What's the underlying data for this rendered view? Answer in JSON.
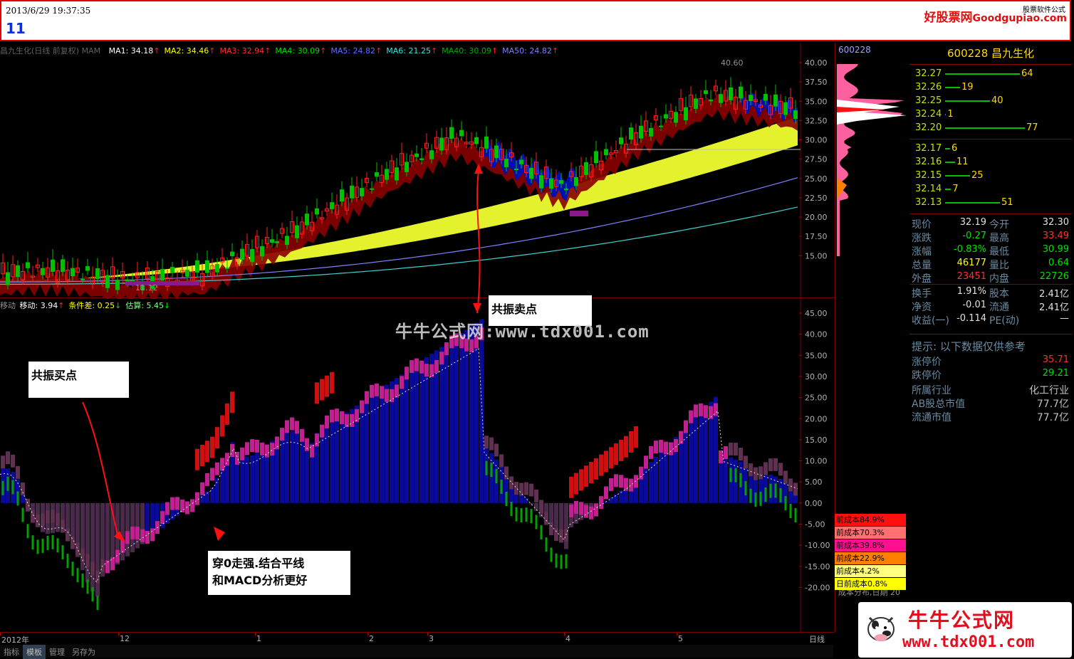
{
  "topbar": {
    "datetime": "2013/6/29 19:37:35",
    "number": "11",
    "site_cn": "好股票网",
    "site_en": "Goodgupiao.com",
    "software": "股票软件公式"
  },
  "main_legend": {
    "title": "昌九生化(日线 前复权) MAM",
    "items": [
      {
        "label": "MA1: 34.18",
        "color": "#ffffff",
        "arrow": "↑"
      },
      {
        "label": "MA2: 34.46",
        "color": "#ffff00",
        "arrow": "↑"
      },
      {
        "label": "MA3: 32.94",
        "color": "#ff3030",
        "arrow": "↑"
      },
      {
        "label": "MA4: 30.09",
        "color": "#00e000",
        "arrow": "↑"
      },
      {
        "label": "MA5: 24.82",
        "color": "#6070ff",
        "arrow": "↑"
      },
      {
        "label": "MA6: 21.25",
        "color": "#40e0e0",
        "arrow": "↑"
      },
      {
        "label": "MA40: 30.09",
        "color": "#00b000",
        "arrow": "↑"
      },
      {
        "label": "MA50: 24.82",
        "color": "#8080ff",
        "arrow": "↑"
      }
    ]
  },
  "price_axis": [
    "40.00",
    "37.50",
    "35.00",
    "32.50",
    "30.00",
    "27.50",
    "25.00",
    "22.50",
    "20.00",
    "17.50",
    "15.00"
  ],
  "price_high_label": "40.60",
  "price_low_label": "11.12",
  "sub_legend": {
    "title": "移动",
    "items": [
      {
        "label": "移动: 3.94",
        "color": "#ffffff",
        "arrow": "↑"
      },
      {
        "label": "条件差: 0.25",
        "color": "#ffff00",
        "arrow": "↓"
      },
      {
        "label": "估算: 5.45",
        "color": "#80ff80",
        "arrow": "↓"
      }
    ]
  },
  "osc_axis": [
    "45.00",
    "40.00",
    "35.00",
    "30.00",
    "25.00",
    "20.00",
    "15.00",
    "10.00",
    "5.00",
    "0.00",
    "-5.00",
    "-10.00",
    "-15.00",
    "-20.00"
  ],
  "date_axis": [
    {
      "label": "2012年"
    },
    {
      "label": "12"
    },
    {
      "label": "1"
    },
    {
      "label": "2"
    },
    {
      "label": "3"
    },
    {
      "label": "4"
    },
    {
      "label": "5"
    }
  ],
  "period_label": "日线",
  "callouts": {
    "buy": "共振买点",
    "sell": "共振卖点",
    "note_line1": "穿0走强.结合平线",
    "note_line2": "和MACD分析更好"
  },
  "watermark": "牛牛公式网:www.tdx001.com",
  "chip_panel": {
    "code": "600228",
    "cost_legend": [
      {
        "label": "前成本84.9%",
        "color": "#ff1010"
      },
      {
        "label": "前成本70.3%",
        "color": "#ff7070"
      },
      {
        "label": "前成本39.8%",
        "color": "#ff1090"
      },
      {
        "label": "前成本22.9%",
        "color": "#ff8000"
      },
      {
        "label": "前成本4.2%",
        "color": "#ffff80"
      },
      {
        "label": "日前成本0.8%",
        "color": "#ffff00"
      }
    ],
    "footer": "成本分布,日期",
    "footer_num": "20"
  },
  "quote": {
    "header": "600228 昌九生化",
    "asks": [
      {
        "price": "32.27",
        "qty": "64",
        "bar": 150
      },
      {
        "price": "32.26",
        "qty": "19",
        "bar": 30
      },
      {
        "price": "32.25",
        "qty": "40",
        "bar": 90
      },
      {
        "price": "32.24",
        "qty": "1",
        "bar": 2
      },
      {
        "price": "32.20",
        "qty": "77",
        "bar": 160
      }
    ],
    "bids": [
      {
        "price": "32.17",
        "qty": "6",
        "bar": 10
      },
      {
        "price": "32.16",
        "qty": "11",
        "bar": 20
      },
      {
        "price": "32.15",
        "qty": "25",
        "bar": 50
      },
      {
        "price": "32.14",
        "qty": "7",
        "bar": 12
      },
      {
        "price": "32.13",
        "qty": "51",
        "bar": 110
      }
    ],
    "stats": [
      {
        "k1": "现价",
        "v1": "32.19",
        "c1": "#e0e0e0",
        "k2": "今开",
        "v2": "32.30",
        "c2": "#e0e0e0"
      },
      {
        "k1": "涨跌",
        "v1": "-0.27",
        "c1": "#00e000",
        "k2": "最高",
        "v2": "33.49",
        "c2": "#ff3030"
      },
      {
        "k1": "涨幅",
        "v1": "-0.83%",
        "c1": "#00e000",
        "k2": "最低",
        "v2": "30.99",
        "c2": "#00e000"
      },
      {
        "k1": "总量",
        "v1": "46177",
        "c1": "#ffff00",
        "k2": "量比",
        "v2": "0.64",
        "c2": "#00e000"
      },
      {
        "k1": "外盘",
        "v1": "23451",
        "c1": "#ff3030",
        "k2": "内盘",
        "v2": "22726",
        "c2": "#00e000"
      }
    ],
    "stats2": [
      {
        "k1": "换手",
        "v1": "1.91%",
        "c1": "#e0e0e0",
        "k2": "股本",
        "v2": "2.41亿",
        "c2": "#e0e0e0"
      },
      {
        "k1": "净资",
        "v1": "-0.01",
        "c1": "#e0e0e0",
        "k2": "流通",
        "v2": "2.41亿",
        "c2": "#e0e0e0"
      },
      {
        "k1": "收益(一)",
        "v1": "-0.114",
        "c1": "#e0e0e0",
        "k2": "PE(动)",
        "v2": "—",
        "c2": "#e0e0e0"
      }
    ],
    "tip": "提示: 以下数据仅供参考",
    "limits": [
      {
        "k": "涨停价",
        "v": "35.71",
        "c": "#ff3030"
      },
      {
        "k": "跌停价",
        "v": "29.21",
        "c": "#00e000"
      }
    ],
    "info": [
      {
        "k": "所属行业",
        "v": "化工行业"
      },
      {
        "k": "AB股总市值",
        "v": "77.7亿"
      },
      {
        "k": "流通市值",
        "v": "77.7亿"
      }
    ]
  },
  "bottom_tabs": [
    "指标",
    "模板",
    "管理",
    "另存为"
  ],
  "logo": {
    "name": "牛牛公式网",
    "url": "www.tdx001.com"
  }
}
